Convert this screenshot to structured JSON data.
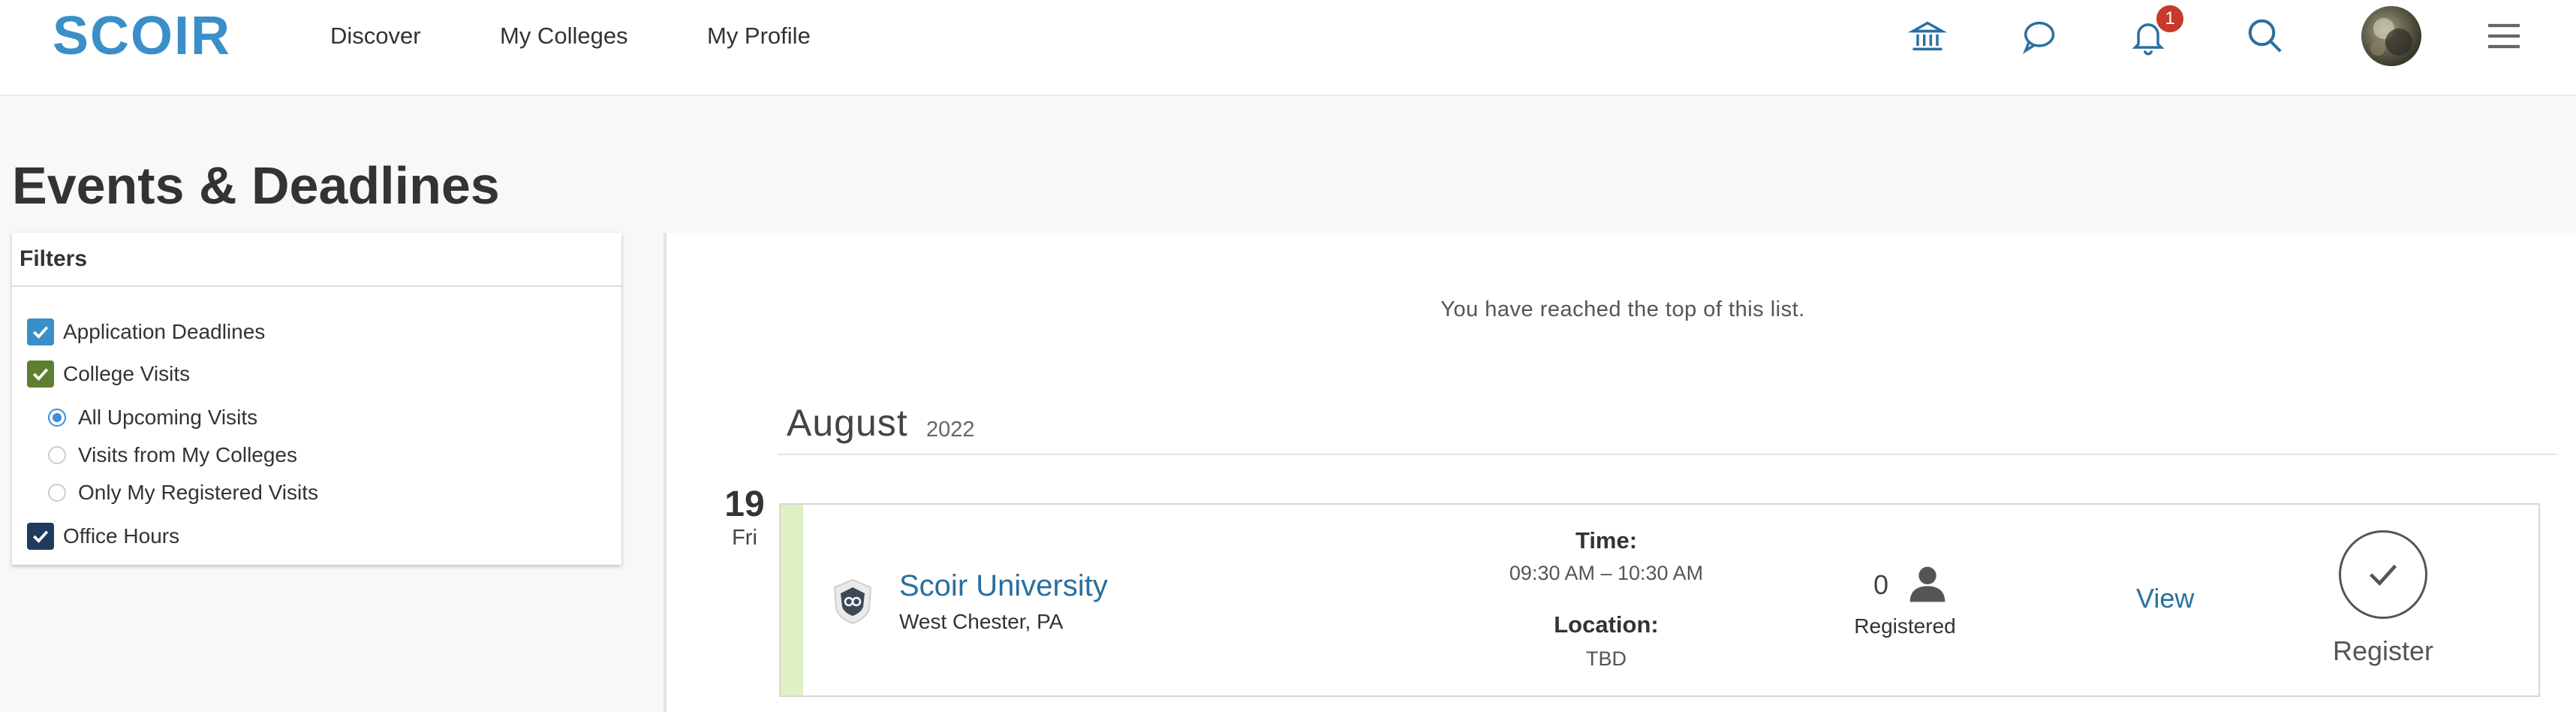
{
  "header": {
    "logo_text": "SCOIR",
    "nav": [
      "Discover",
      "My Colleges",
      "My Profile"
    ],
    "icons": [
      "institution-icon",
      "chat-icon",
      "bell-icon",
      "search-icon",
      "avatar",
      "menu-icon"
    ],
    "notification_count": "1",
    "colors": {
      "brand": "#3b8fc9",
      "badge": "#c6392b"
    }
  },
  "page": {
    "title": "Events & Deadlines"
  },
  "filters": {
    "heading": "Filters",
    "checkboxes": [
      {
        "label": "Application Deadlines",
        "checked": true,
        "color": "#3b8fc9"
      },
      {
        "label": "College Visits",
        "checked": true,
        "color": "#5f7f30"
      },
      {
        "label": "Office Hours",
        "checked": true,
        "color": "#1f3a5c"
      }
    ],
    "visit_options": [
      {
        "label": "All Upcoming Visits",
        "selected": true
      },
      {
        "label": "Visits from My Colleges",
        "selected": false
      },
      {
        "label": "Only My Registered Visits",
        "selected": false
      }
    ]
  },
  "list": {
    "top_message": "You have reached the top of this list.",
    "month": "August",
    "year": "2022",
    "events": [
      {
        "day_num": "19",
        "day_name": "Fri",
        "college": "Scoir University",
        "location": "West Chester, PA",
        "time_label": "Time:",
        "time_value": "09:30 AM – 10:30 AM",
        "location_label": "Location:",
        "location_value": "TBD",
        "registered_count": "0",
        "registered_label": "Registered",
        "view_label": "View",
        "register_label": "Register",
        "accent_color": "#e0f0c5"
      }
    ]
  }
}
